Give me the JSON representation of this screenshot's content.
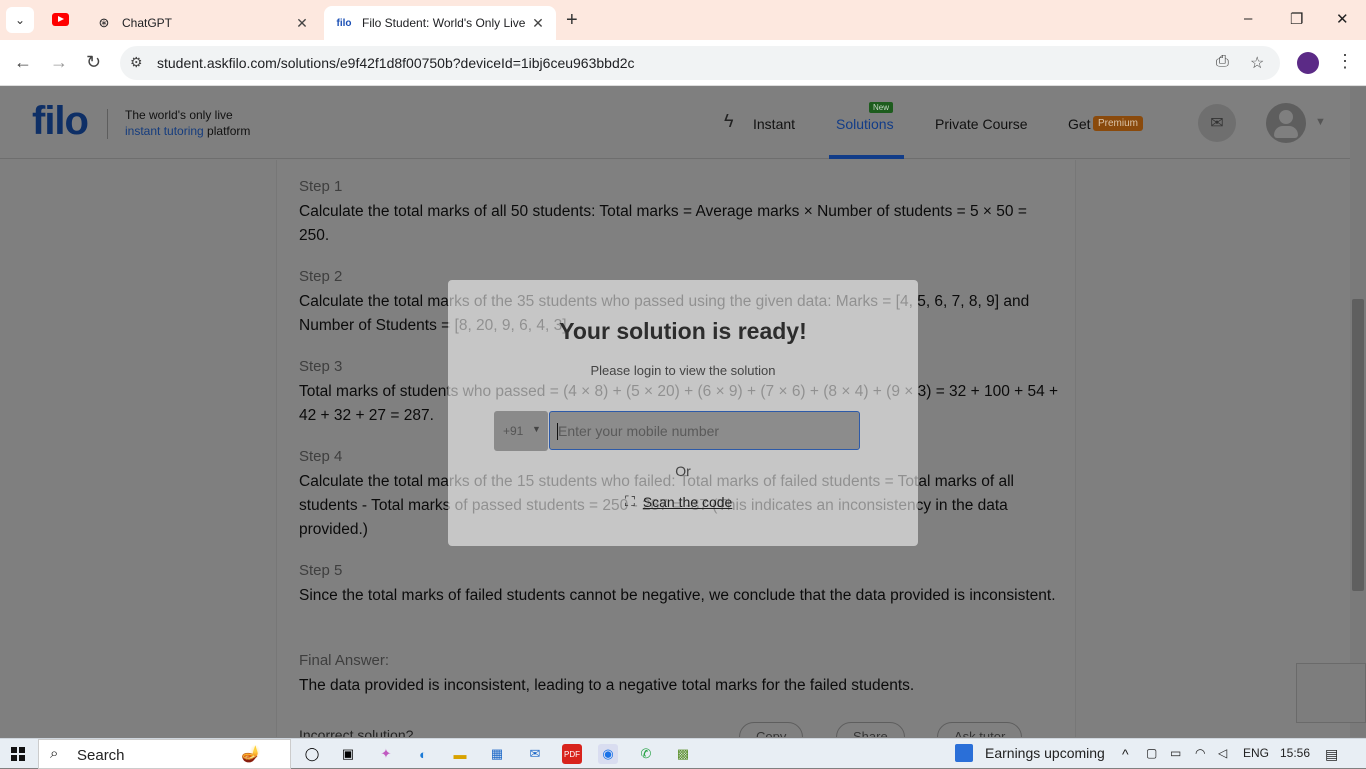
{
  "browser": {
    "tabs": [
      {
        "title": "ChatGPT",
        "active": false
      },
      {
        "title": "Filo Student: World's Only Live I",
        "active": true
      }
    ],
    "url": "student.askfilo.com/solutions/e9f42f1d8f00750b?deviceId=1ibj6ceu963bbd2c",
    "window_controls": [
      "–",
      "❐",
      "✕"
    ]
  },
  "header": {
    "logo": "filo",
    "tagline_line1": "The world's only live",
    "tagline_hl": "instant tutoring",
    "tagline_rest": " platform",
    "nav": [
      {
        "label": "Instant",
        "active": false
      },
      {
        "label": "Solutions",
        "active": true,
        "badge": "New"
      },
      {
        "label": "Private Course",
        "active": false
      },
      {
        "label": "Get",
        "active": false,
        "badge": "Premium"
      }
    ]
  },
  "solution": {
    "steps": [
      {
        "title": "Step 1",
        "text": "Calculate the total marks of all 50 students: Total marks = Average marks × Number of students = 5 × 50 = 250."
      },
      {
        "title": "Step 2",
        "text": "Calculate the total marks of the 35 students who passed using the given data: Marks = [4, 5, 6, 7, 8, 9] and Number of Students = [8, 20, 9, 6, 4, 3]"
      },
      {
        "title": "Step 3",
        "text": "Total marks of students who passed = (4 × 8) + (5 × 20) + (6 × 9) + (7 × 6) + (8 × 4) + (9 × 3) = 32 + 100 + 54 + 42 + 32 + 27 = 287."
      },
      {
        "title": "Step 4",
        "text": "Calculate the total marks of the 15 students who failed: Total marks of failed students = Total marks of all students - Total marks of passed students = 250 - 287 = -37 (This indicates an inconsistency in the data provided.)"
      },
      {
        "title": "Step 5",
        "text": "Since the total marks of failed students cannot be negative, we conclude that the data provided is inconsistent."
      },
      {
        "title": "Final Answer:",
        "text": "The data provided is inconsistent, leading to a negative total marks for the failed students."
      }
    ],
    "incorrect_label": "Incorrect solution?",
    "actions": [
      "Copy",
      "Share",
      "Ask tutor"
    ]
  },
  "modal": {
    "title": "Your solution is ready!",
    "subtitle": "Please login to view the solution",
    "country_code": "+91",
    "phone_placeholder": "Enter your mobile number",
    "or": "Or",
    "scan": "Scan the code"
  },
  "taskbar": {
    "search": "Search",
    "news": "Earnings upcoming",
    "lang": "ENG",
    "time": "15:56"
  }
}
